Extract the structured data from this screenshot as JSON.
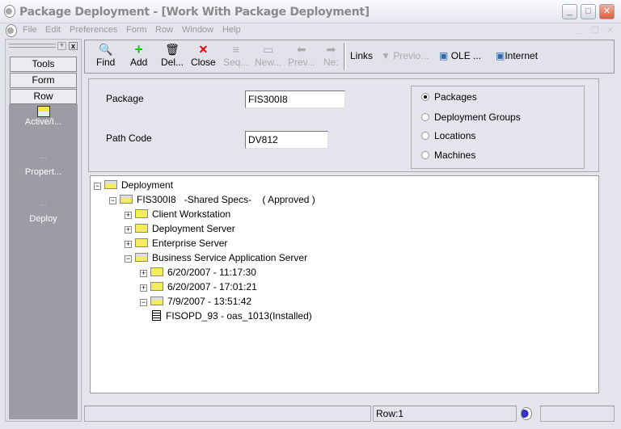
{
  "window": {
    "title": "Package Deployment - [Work With Package Deployment]"
  },
  "menu": [
    "File",
    "Edit",
    "Preferences",
    "Form",
    "Row",
    "Window",
    "Help"
  ],
  "sidebar": {
    "buttons": [
      "Tools",
      "Form",
      "Row"
    ],
    "items": [
      "Active/I...",
      "Propert...",
      "Deploy"
    ]
  },
  "toolbar": {
    "buttons": [
      {
        "label": "Find",
        "icon": "find-icon"
      },
      {
        "label": "Add",
        "icon": "plus-icon"
      },
      {
        "label": "Del...",
        "icon": "trash-icon"
      },
      {
        "label": "Close",
        "icon": "x-icon"
      },
      {
        "label": "Seq...",
        "icon": "sequence-icon"
      },
      {
        "label": "New...",
        "icon": "new-icon"
      },
      {
        "label": "Prev...",
        "icon": "prev-icon"
      },
      {
        "label": "Ne:",
        "icon": "next-icon"
      }
    ],
    "links_label": "Links",
    "links": [
      "Previo...",
      "OLE ...",
      "Internet"
    ]
  },
  "form": {
    "package_label": "Package",
    "package_value": "FIS300I8",
    "path_label": "Path Code",
    "path_value": "DV812",
    "radios": [
      "Packages",
      "Deployment Groups",
      "Locations",
      "Machines"
    ],
    "selected": "Packages"
  },
  "tree": [
    {
      "text": "Deployment",
      "level": 0,
      "state": "open"
    },
    {
      "text": "FIS300I8   -Shared Specs-    ( Approved )",
      "level": 1,
      "state": "open"
    },
    {
      "text": "Client Workstation",
      "level": 2,
      "state": "closed"
    },
    {
      "text": "Deployment Server",
      "level": 2,
      "state": "closed"
    },
    {
      "text": "Enterprise Server",
      "level": 2,
      "state": "closed"
    },
    {
      "text": "Business Service Application Server",
      "level": 2,
      "state": "open"
    },
    {
      "text": "6/20/2007 - 11:17:30",
      "level": 3,
      "state": "closed"
    },
    {
      "text": "6/20/2007 - 17:01:21",
      "level": 3,
      "state": "closed"
    },
    {
      "text": "7/9/2007 - 13:51:42",
      "level": 3,
      "state": "open"
    },
    {
      "text": "FISOPD_93 - oas_1013(Installed)",
      "level": 4,
      "state": "leaf"
    }
  ],
  "status": {
    "row": "Row:1"
  }
}
